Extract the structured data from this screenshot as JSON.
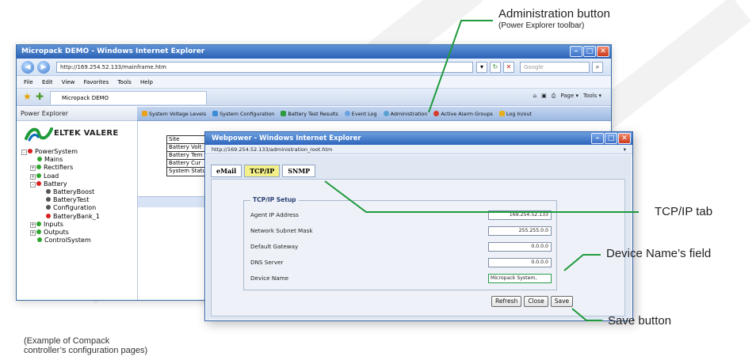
{
  "ie": {
    "title": "Micropack DEMO - Windows Internet Explorer",
    "url": "http://169.254.52.133/mainframe.htm",
    "search_placeholder": "Google",
    "menu": [
      "File",
      "Edit",
      "View",
      "Favorites",
      "Tools",
      "Help"
    ],
    "tab_title": "Micropack DEMO",
    "fav_tools": [
      "Page ▾",
      "Tools ▾"
    ]
  },
  "power_explorer": {
    "header": "Power Explorer",
    "logo_text": "ELTEK VALERE",
    "tree": [
      {
        "label": "PowerSystem",
        "level": 0,
        "status": "red",
        "expander": "-"
      },
      {
        "label": "Mains",
        "level": 1,
        "status": "green",
        "expander": ""
      },
      {
        "label": "Rectifiers",
        "level": 1,
        "status": "green",
        "expander": "+"
      },
      {
        "label": "Load",
        "level": 1,
        "status": "green",
        "expander": "+"
      },
      {
        "label": "Battery",
        "level": 1,
        "status": "red",
        "expander": "-"
      },
      {
        "label": "BatteryBoost",
        "level": 2,
        "status": "grey",
        "expander": ""
      },
      {
        "label": "BatteryTest",
        "level": 2,
        "status": "grey",
        "expander": ""
      },
      {
        "label": "Configuration",
        "level": 2,
        "status": "grey",
        "expander": ""
      },
      {
        "label": "BatteryBank_1",
        "level": 2,
        "status": "red",
        "expander": ""
      },
      {
        "label": "Inputs",
        "level": 1,
        "status": "green",
        "expander": "+"
      },
      {
        "label": "Outputs",
        "level": 1,
        "status": "green",
        "expander": "+"
      },
      {
        "label": "ControlSystem",
        "level": 1,
        "status": "green",
        "expander": ""
      }
    ]
  },
  "toolbar": [
    "System Voltage Levels",
    "System Configuration",
    "Battery Test Results",
    "Event Log",
    "Administration",
    "Active Alarm Groups",
    "Log In/out"
  ],
  "site_table": [
    "Site",
    "Battery Volt",
    "Battery Tem",
    "Battery Cur",
    "System Statu"
  ],
  "popup": {
    "title": "Webpower - Windows Internet Explorer",
    "url": "http://169.254.52.133/administration_root.htm",
    "tabs": [
      "eMail",
      "TCP/IP",
      "SNMP"
    ],
    "legend": "TCP/IP Setup",
    "fields": [
      {
        "label": "Agent IP Address",
        "value": "169.254.52.133"
      },
      {
        "label": "Network Subnet Mask",
        "value": "255.255.0.0"
      },
      {
        "label": "Default Gateway",
        "value": "0.0.0.0"
      },
      {
        "label": "DNS Server",
        "value": "0.0.0.0"
      },
      {
        "label": "Device Name",
        "value": "Micropack System,"
      }
    ],
    "buttons": [
      "Refresh",
      "Close",
      "Save"
    ]
  },
  "callouts": {
    "admin_title": "Administration button",
    "admin_sub": "(Power Explorer toolbar)",
    "tcpip": "TCP/IP tab",
    "device_name": "Device Name’s field",
    "save": "Save button"
  },
  "caption": [
    "(Example of Compack",
    "controller’s configuration pages)"
  ]
}
